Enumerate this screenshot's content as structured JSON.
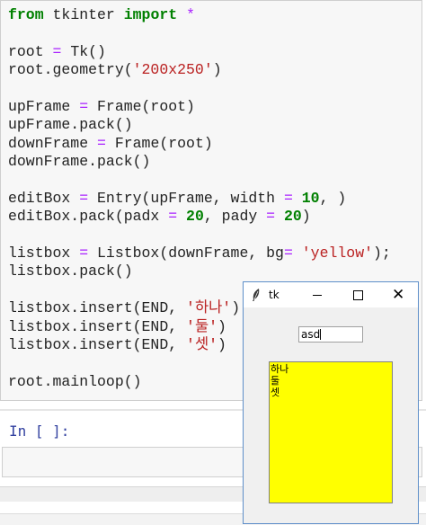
{
  "code_cell": {
    "lines": [
      [
        {
          "t": "from",
          "c": "kw"
        },
        {
          "t": " tkinter ",
          "c": ""
        },
        {
          "t": "import",
          "c": "kw"
        },
        {
          "t": " ",
          "c": ""
        },
        {
          "t": "*",
          "c": "op"
        }
      ],
      [],
      [
        {
          "t": "root ",
          "c": ""
        },
        {
          "t": "=",
          "c": "op"
        },
        {
          "t": " Tk()",
          "c": ""
        }
      ],
      [
        {
          "t": "root.geometry(",
          "c": ""
        },
        {
          "t": "'200x250'",
          "c": "st"
        },
        {
          "t": ")",
          "c": ""
        }
      ],
      [],
      [
        {
          "t": "upFrame ",
          "c": ""
        },
        {
          "t": "=",
          "c": "op"
        },
        {
          "t": " Frame(root)",
          "c": ""
        }
      ],
      [
        {
          "t": "upFrame.pack()",
          "c": ""
        }
      ],
      [
        {
          "t": "downFrame ",
          "c": ""
        },
        {
          "t": "=",
          "c": "op"
        },
        {
          "t": " Frame(root)",
          "c": ""
        }
      ],
      [
        {
          "t": "downFrame.pack()",
          "c": ""
        }
      ],
      [],
      [
        {
          "t": "editBox ",
          "c": ""
        },
        {
          "t": "=",
          "c": "op"
        },
        {
          "t": " Entry(upFrame, width ",
          "c": ""
        },
        {
          "t": "=",
          "c": "op"
        },
        {
          "t": " ",
          "c": ""
        },
        {
          "t": "10",
          "c": "kw"
        },
        {
          "t": ", )",
          "c": ""
        }
      ],
      [
        {
          "t": "editBox.pack(padx ",
          "c": ""
        },
        {
          "t": "=",
          "c": "op"
        },
        {
          "t": " ",
          "c": ""
        },
        {
          "t": "20",
          "c": "kw"
        },
        {
          "t": ", pady ",
          "c": ""
        },
        {
          "t": "=",
          "c": "op"
        },
        {
          "t": " ",
          "c": ""
        },
        {
          "t": "20",
          "c": "kw"
        },
        {
          "t": ")",
          "c": ""
        }
      ],
      [],
      [
        {
          "t": "listbox ",
          "c": ""
        },
        {
          "t": "=",
          "c": "op"
        },
        {
          "t": " Listbox(downFrame, bg",
          "c": ""
        },
        {
          "t": "=",
          "c": "op"
        },
        {
          "t": " ",
          "c": ""
        },
        {
          "t": "'yellow'",
          "c": "st"
        },
        {
          "t": ");",
          "c": ""
        }
      ],
      [
        {
          "t": "listbox.pack()",
          "c": ""
        }
      ],
      [],
      [
        {
          "t": "listbox.insert(END, ",
          "c": ""
        },
        {
          "t": "'하나'",
          "c": "st"
        },
        {
          "t": ")",
          "c": ""
        }
      ],
      [
        {
          "t": "listbox.insert(END, ",
          "c": ""
        },
        {
          "t": "'둘'",
          "c": "st"
        },
        {
          "t": ")",
          "c": ""
        }
      ],
      [
        {
          "t": "listbox.insert(END, ",
          "c": ""
        },
        {
          "t": "'셋'",
          "c": "st"
        },
        {
          "t": ")",
          "c": ""
        }
      ],
      [],
      [
        {
          "t": "root.mainloop()",
          "c": ""
        }
      ]
    ]
  },
  "next_cell": {
    "prompt": "In [ ]:",
    "value": ""
  },
  "tk_window": {
    "title": "tk",
    "close_glyph": "✕",
    "entry_value": "asd",
    "listbox_items": [
      "하나",
      "둘",
      "셋"
    ],
    "listbox_bg": "#ffff00"
  },
  "colors": {
    "keyword": "#008000",
    "operator": "#aa22ff",
    "string": "#ba2121",
    "prompt": "#303f9f",
    "window_border": "#5e8fc9"
  }
}
